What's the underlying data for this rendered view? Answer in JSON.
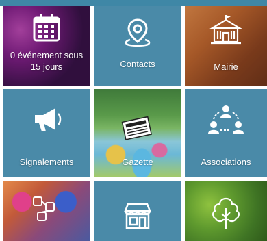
{
  "colors": {
    "tile_blue": "#4a8aa8",
    "top_bar": "#3f87a6",
    "text": "#ffffff"
  },
  "tiles": [
    {
      "label_line1": "0 événement sous",
      "label_line2": "15 jours",
      "icon": "calendar-icon"
    },
    {
      "label": "Contacts",
      "icon": "location-pin-icon"
    },
    {
      "label": "Mairie",
      "icon": "town-hall-icon"
    },
    {
      "label": "Signalements",
      "icon": "megaphone-icon"
    },
    {
      "label": "Gazette",
      "icon": "newspaper-icon"
    },
    {
      "label": "Associations",
      "icon": "people-network-icon"
    },
    {
      "label": "",
      "icon": "social-media-icon"
    },
    {
      "label": "",
      "icon": "shop-icon"
    },
    {
      "label": "",
      "icon": "tree-icon"
    }
  ]
}
